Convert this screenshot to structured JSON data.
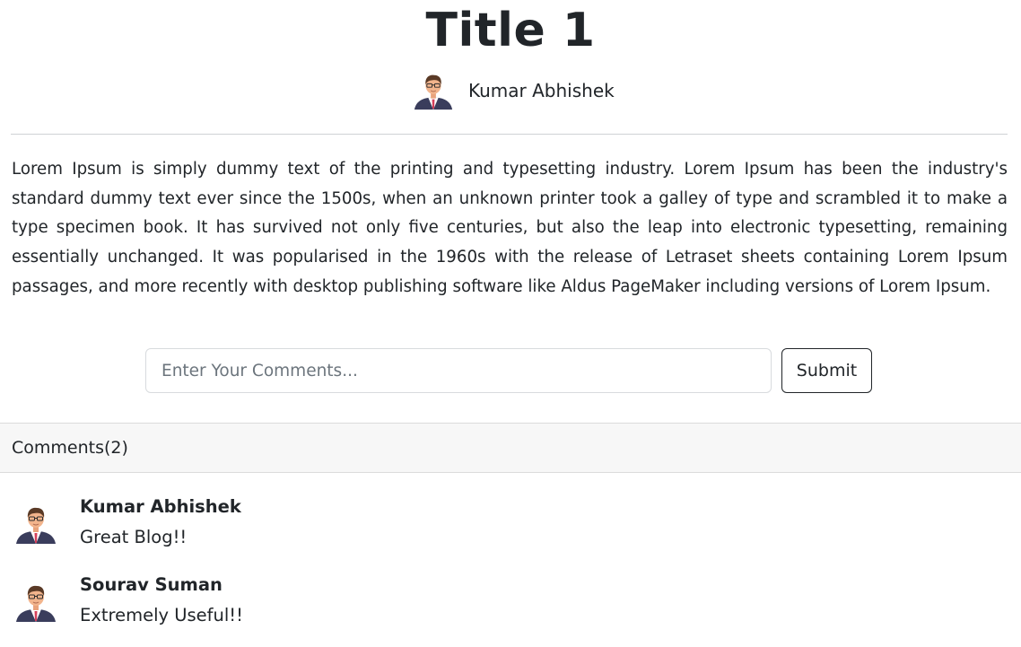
{
  "post": {
    "title": "Title 1",
    "author": "Kumar Abhishek",
    "body": "Lorem Ipsum is simply dummy text of the printing and typesetting industry. Lorem Ipsum has been the industry's standard dummy text ever since the 1500s, when an unknown printer took a galley of type and scrambled it to make a type specimen book. It has survived not only five centuries, but also the leap into electronic typesetting, remaining essentially unchanged. It was popularised in the 1960s with the release of Letraset sheets containing Lorem Ipsum passages, and more recently with desktop publishing software like Aldus PageMaker including versions of Lorem Ipsum."
  },
  "comment_form": {
    "placeholder": "Enter Your Comments...",
    "value": "",
    "submit_label": "Submit"
  },
  "comments_section": {
    "header": "Comments(2)",
    "items": [
      {
        "author": "Kumar Abhishek",
        "text": "Great Blog!!"
      },
      {
        "author": "Sourav Suman",
        "text": "Extremely Useful!!"
      }
    ]
  },
  "icons": {
    "avatar": "user-avatar-icon"
  },
  "colors": {
    "text": "#212529",
    "muted": "#6c757d",
    "header_bg": "#f7f7f7",
    "avatar_suit": "#3a3d5c",
    "avatar_tie": "#d43f5a",
    "avatar_skin": "#f2b48c",
    "avatar_hair": "#5a3a26"
  }
}
